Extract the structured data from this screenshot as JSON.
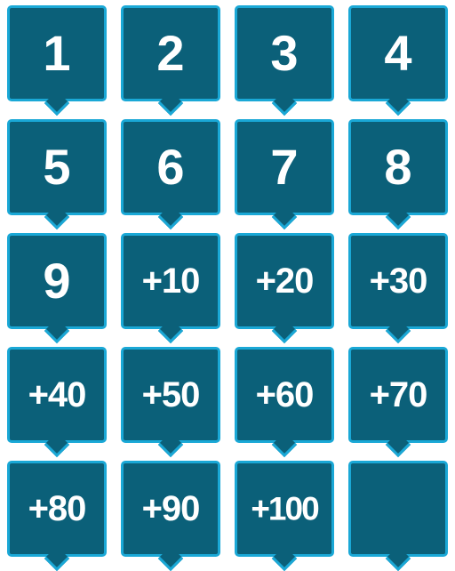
{
  "markers": [
    {
      "label": "1"
    },
    {
      "label": "2"
    },
    {
      "label": "3"
    },
    {
      "label": "4"
    },
    {
      "label": "5"
    },
    {
      "label": "6"
    },
    {
      "label": "7"
    },
    {
      "label": "8"
    },
    {
      "label": "9"
    },
    {
      "label": "+10"
    },
    {
      "label": "+20"
    },
    {
      "label": "+30"
    },
    {
      "label": "+40"
    },
    {
      "label": "+50"
    },
    {
      "label": "+60"
    },
    {
      "label": "+70"
    },
    {
      "label": "+80"
    },
    {
      "label": "+90"
    },
    {
      "label": "+100"
    },
    {
      "label": ""
    }
  ],
  "colors": {
    "fill": "#0b6079",
    "border": "#1aa8d6",
    "text": "#ffffff"
  }
}
